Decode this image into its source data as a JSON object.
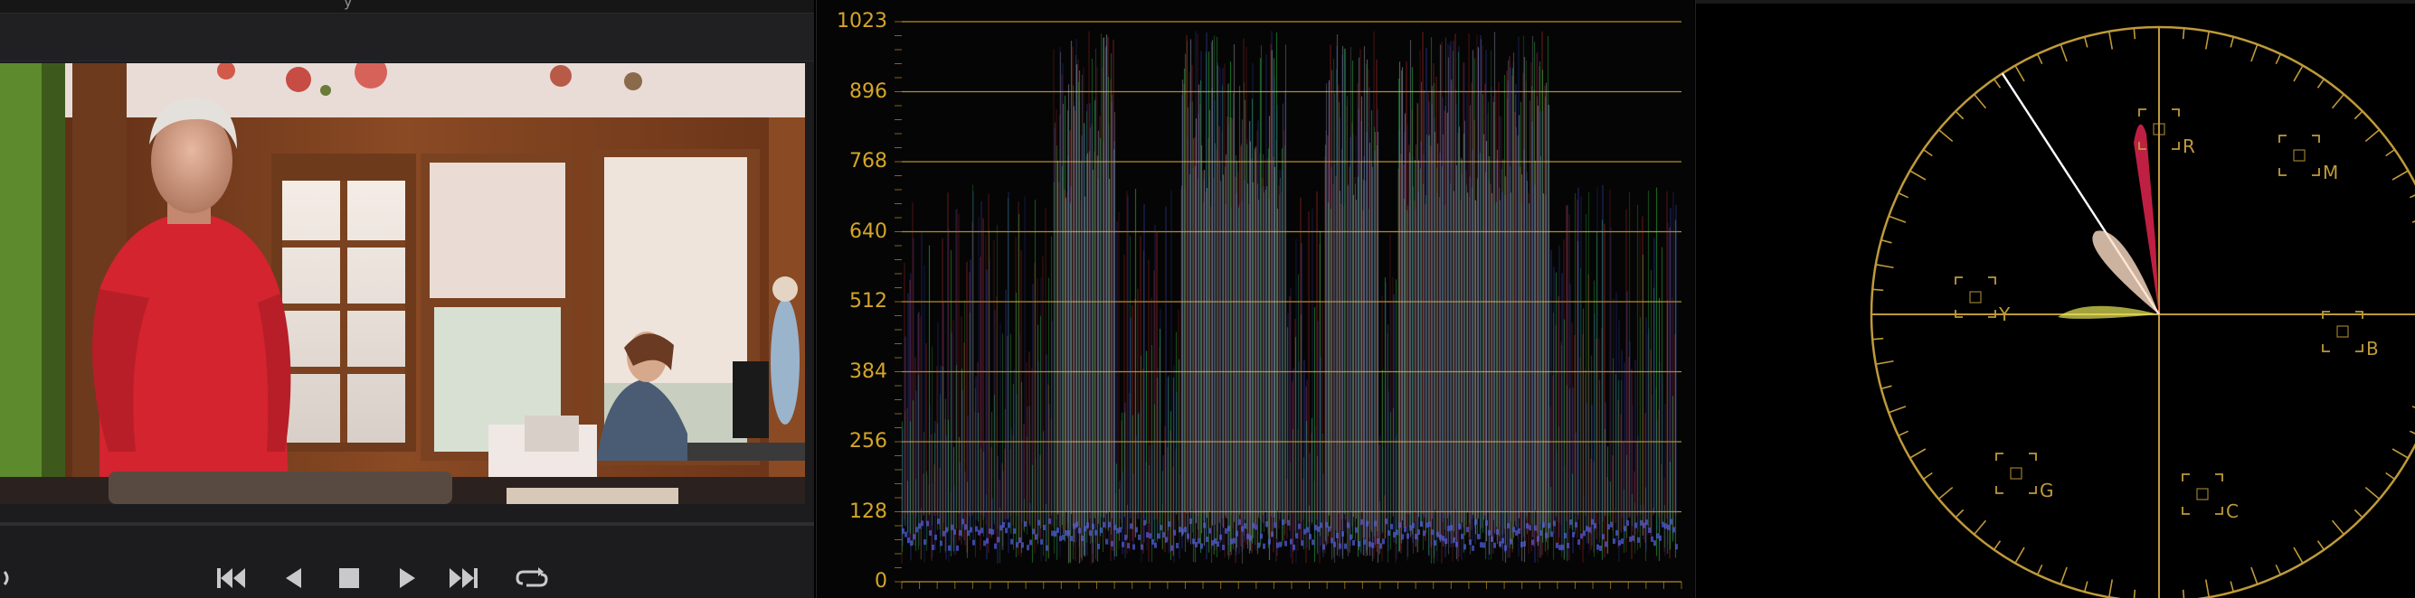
{
  "viewer": {
    "title_fragment": "y",
    "audio_icon": "speaker-icon",
    "controls": [
      {
        "name": "skip-to-start-button",
        "icon": "skip-start-icon"
      },
      {
        "name": "step-back-button",
        "icon": "step-back-icon"
      },
      {
        "name": "stop-button",
        "icon": "stop-icon"
      },
      {
        "name": "play-button",
        "icon": "play-icon"
      },
      {
        "name": "skip-to-end-button",
        "icon": "skip-end-icon"
      },
      {
        "name": "loop-button",
        "icon": "loop-icon"
      }
    ]
  },
  "waveform": {
    "scale": [
      "1023",
      "896",
      "768",
      "640",
      "512",
      "384",
      "256",
      "128",
      "0"
    ],
    "gridline_color": "#d4a528"
  },
  "vectorscope": {
    "targets": [
      "R",
      "M",
      "Y",
      "B",
      "G",
      "C"
    ],
    "graticule_color": "#bf9a3a",
    "skin_tone_line_color": "#ffffff"
  }
}
